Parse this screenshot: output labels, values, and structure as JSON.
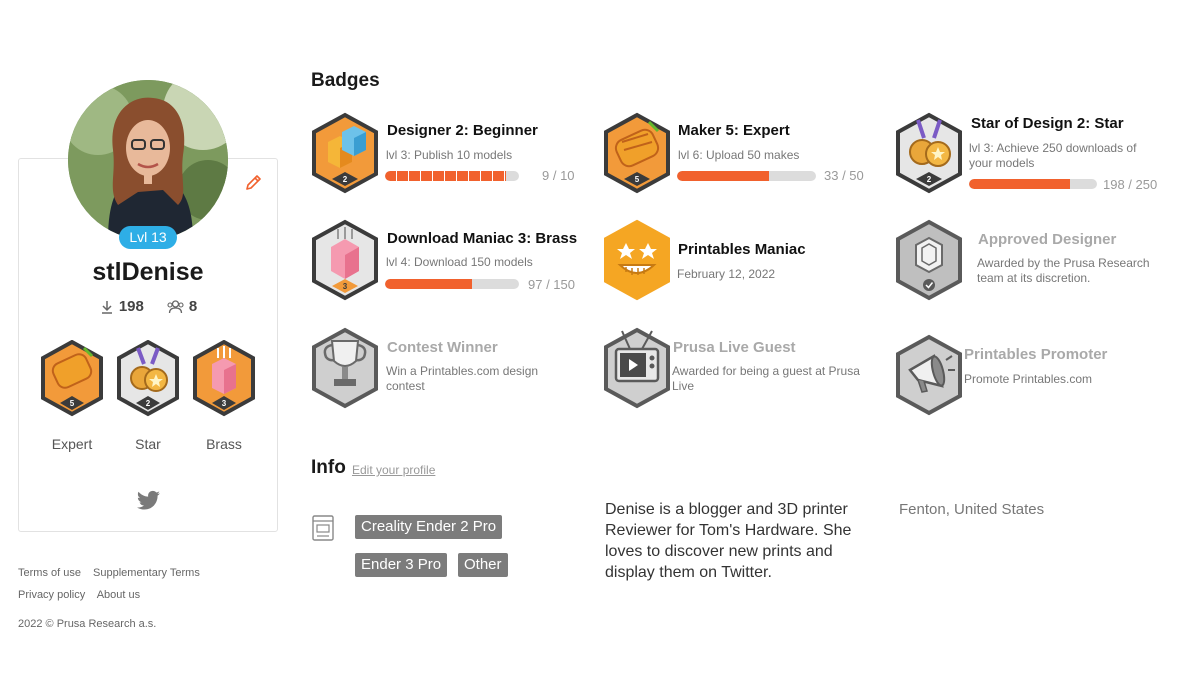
{
  "profile": {
    "level": "Lvl 13",
    "username": "stlDenise",
    "downloads": "198",
    "followers": "8",
    "featured_badges": [
      {
        "label": "Expert",
        "icon": "rocket-icon",
        "tier": "5"
      },
      {
        "label": "Star",
        "icon": "medal-icon",
        "tier": "2"
      },
      {
        "label": "Brass",
        "icon": "cube-icon",
        "tier": "3"
      }
    ],
    "social_icon": "twitter-icon"
  },
  "footer": {
    "terms": "Terms of use",
    "supplementary": "Supplementary Terms",
    "privacy": "Privacy policy",
    "about": "About us",
    "copyright": "2022 © Prusa Research a.s."
  },
  "badges": {
    "title": "Badges",
    "items": [
      {
        "title": "Designer 2: Beginner",
        "desc": "lvl 3: Publish 10 models",
        "progress_text": "9 / 10",
        "progress": 0.9,
        "tier": "2"
      },
      {
        "title": "Maker 5: Expert",
        "desc": "lvl 6: Upload 50 makes",
        "progress_text": "33 / 50",
        "progress": 0.66,
        "tier": "5"
      },
      {
        "title": "Star of Design 2: Star",
        "desc": "lvl 3: Achieve 250 downloads of your models",
        "progress_text": "198 / 250",
        "progress": 0.792,
        "tier": "2"
      },
      {
        "title": "Download Maniac 3: Brass",
        "desc": "lvl 4: Download 150 models",
        "progress_text": "97 / 150",
        "progress": 0.647,
        "tier": "3"
      },
      {
        "title": "Printables Maniac",
        "desc": "February 12, 2022"
      },
      {
        "title": "Approved Designer",
        "desc": "Awarded by the Prusa Research team at its discretion."
      },
      {
        "title": "Contest Winner",
        "desc": "Win a Printables.com design contest"
      },
      {
        "title": "Prusa Live Guest",
        "desc": "Awarded for being a guest at Prusa Live"
      },
      {
        "title": "Printables Promoter",
        "desc": "Promote Printables.com"
      }
    ]
  },
  "info": {
    "title": "Info",
    "edit_link": "Edit your profile",
    "printers": [
      "Creality Ender 2 Pro",
      "Ender 3 Pro",
      "Other"
    ],
    "bio": "Denise is a blogger and 3D printer Reviewer for Tom's Hardware. She loves to discover new prints and display them on Twitter.",
    "location": "Fenton, United States"
  },
  "colors": {
    "accent": "#f1612d",
    "level_pill": "#2eaee6",
    "badge_border": "#3b3b3b",
    "tag_bg": "#7c7c7c"
  }
}
